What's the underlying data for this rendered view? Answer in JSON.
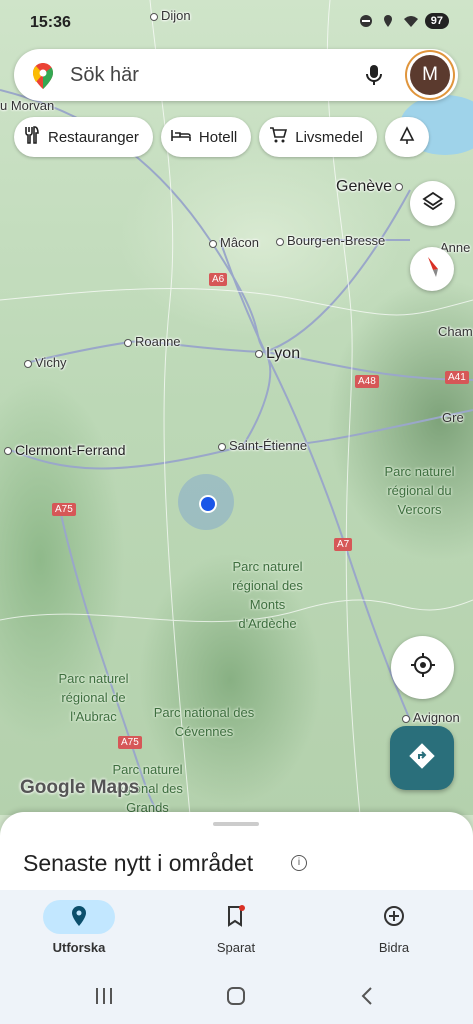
{
  "status_bar": {
    "time": "15:36",
    "battery": "97"
  },
  "search": {
    "placeholder": "Sök här",
    "avatar_letter": "M"
  },
  "chips": [
    {
      "label": "Restauranger",
      "icon": "fork-knife-icon"
    },
    {
      "label": "Hotell",
      "icon": "bed-icon"
    },
    {
      "label": "Livsmedel",
      "icon": "cart-icon"
    }
  ],
  "map": {
    "places": [
      {
        "name": "Dijon"
      },
      {
        "name": "Mâcon"
      },
      {
        "name": "Bourg-en-Bresse"
      },
      {
        "name": "Genève"
      },
      {
        "name": "Roanne"
      },
      {
        "name": "Vichy"
      },
      {
        "name": "Lyon"
      },
      {
        "name": "Clermont-Ferrand"
      },
      {
        "name": "Saint-Étienne"
      },
      {
        "name": "Avignon"
      },
      {
        "name": "Cham"
      },
      {
        "name": "Gre"
      },
      {
        "name": "Anne"
      },
      {
        "name": "u Morvan"
      }
    ],
    "parks": [
      {
        "name": "Parc naturel régional du Vercors"
      },
      {
        "name": "Parc naturel régional des Monts d'Ardèche"
      },
      {
        "name": "Parc naturel régional de l'Aubrac"
      },
      {
        "name": "Parc national des Cévennes"
      },
      {
        "name": "Parc naturel régional des Grands"
      }
    ],
    "highways": [
      "A6",
      "A48",
      "A41",
      "A75",
      "A7",
      "A75"
    ],
    "logo": "Google Maps"
  },
  "sheet": {
    "title": "Senaste nytt i området"
  },
  "bottom_nav": [
    {
      "label": "Utforska",
      "icon": "explore-pin-icon",
      "active": true
    },
    {
      "label": "Sparat",
      "icon": "bookmark-icon",
      "active": false
    },
    {
      "label": "Bidra",
      "icon": "add-circle-icon",
      "active": false
    }
  ],
  "colors": {
    "accent": "#2a6f7b",
    "active_pill": "#c2e7ff",
    "location_dot": "#1a56e8"
  }
}
